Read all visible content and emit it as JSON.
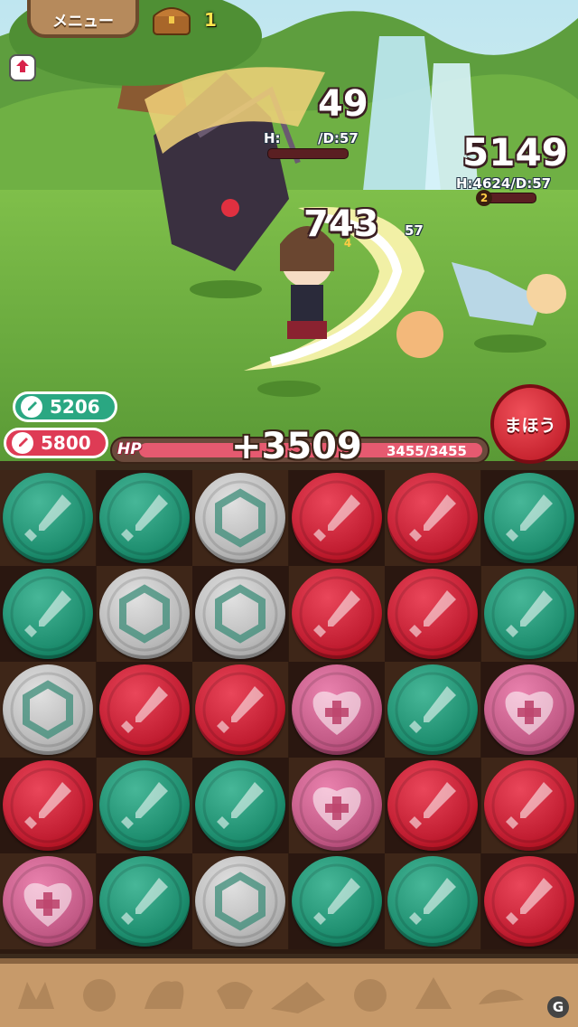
{
  "header": {
    "menu_label": "メニュー",
    "chest_count": "1"
  },
  "battle": {
    "enemy_damage_1": "5149",
    "enemy_stats_1": "H:4624/D:57",
    "enemy_turn_1": "2",
    "enemy_damage_top": "49",
    "enemy_stats_top": "H:",
    "enemy_stats_top_suffix": "/D:57",
    "enemy_damage_mid": "743",
    "enemy_turn_mid": "4",
    "enemy_stats_mid_suffix": "57"
  },
  "party": {
    "attack_green": "5206",
    "attack_red": "5800",
    "magic_label": "まほう",
    "hp_label": "HP",
    "heal_amount": "+3509",
    "hp_current": 3455,
    "hp_max": 3455,
    "hp_text": "3455/3455"
  },
  "board": {
    "rows": [
      [
        "green",
        "green",
        "silver",
        "red",
        "red",
        "green"
      ],
      [
        "green",
        "silver",
        "silver",
        "red",
        "red",
        "green"
      ],
      [
        "silver",
        "red",
        "red",
        "pink",
        "green",
        "pink"
      ],
      [
        "red",
        "green",
        "green",
        "pink",
        "red",
        "red"
      ],
      [
        "pink",
        "green",
        "silver",
        "green",
        "green",
        "red"
      ]
    ],
    "orb_types": {
      "green": {
        "color": "#1f8f70",
        "icon": "sword-icon"
      },
      "red": {
        "color": "#c21e32",
        "icon": "sword-icon"
      },
      "silver": {
        "color": "#b9b9b9",
        "icon": "hexagon-icon"
      },
      "pink": {
        "color": "#c25a86",
        "icon": "heart-icon"
      }
    }
  }
}
